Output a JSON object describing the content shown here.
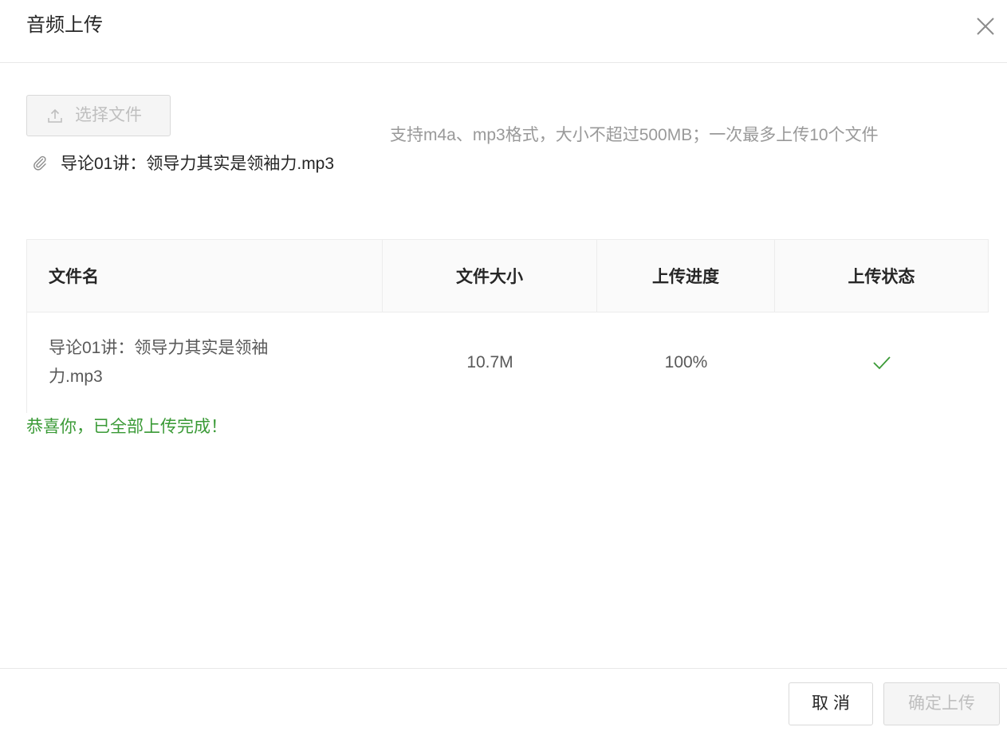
{
  "modal": {
    "title": "音频上传"
  },
  "upload": {
    "select_label": "选择文件",
    "hint": "支持m4a、mp3格式，大小不超过500MB；一次最多上传10个文件",
    "selected_file": "导论01讲：领导力其实是领袖力.mp3"
  },
  "table": {
    "columns": [
      "文件名",
      "文件大小",
      "上传进度",
      "上传状态"
    ],
    "rows": [
      {
        "name": "导论01讲：领导力其实是领袖力.mp3",
        "size": "10.7M",
        "progress": "100%",
        "status_icon": "check-icon"
      }
    ]
  },
  "status": {
    "message": "恭喜你，已全部上传完成！"
  },
  "footer": {
    "cancel_label": "取消",
    "confirm_label": "确定上传"
  },
  "colors": {
    "success": "#3a9a36",
    "disabled_text": "#bfbfbf",
    "hint_text": "#999999"
  }
}
